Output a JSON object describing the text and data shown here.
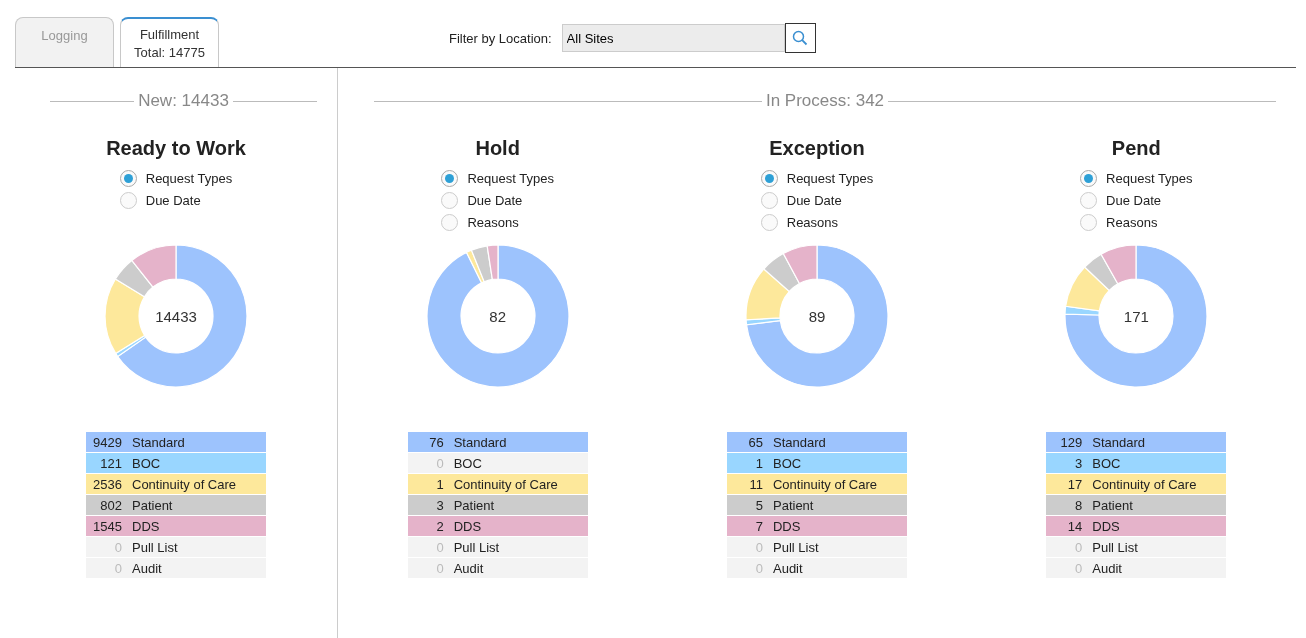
{
  "tabs": [
    {
      "label": "Logging",
      "selected": false
    },
    {
      "label": "Fulfillment",
      "sub": "Total: 14775",
      "selected": true
    }
  ],
  "filter": {
    "label": "Filter by Location:",
    "value": "All Sites"
  },
  "sections": [
    {
      "heading": "New: 14433",
      "panels": [
        {
          "title": "Ready to Work",
          "options": [
            {
              "label": "Request Types",
              "selected": true
            },
            {
              "label": "Due Date",
              "selected": false
            }
          ],
          "total": "14433",
          "legend": [
            {
              "count": "9429",
              "label": "Standard",
              "color": "#9dc3fd",
              "muted": false
            },
            {
              "count": "121",
              "label": "BOC",
              "color": "#99d6ff",
              "muted": false
            },
            {
              "count": "2536",
              "label": "Continuity of Care",
              "color": "#fde89b",
              "muted": false
            },
            {
              "count": "802",
              "label": "Patient",
              "color": "#cccccc",
              "muted": false
            },
            {
              "count": "1545",
              "label": "DDS",
              "color": "#e5b3ca",
              "muted": false
            },
            {
              "count": "0",
              "label": "Pull List",
              "color": "#f3f3f3",
              "muted": true
            },
            {
              "count": "0",
              "label": "Audit",
              "color": "#f3f3f3",
              "muted": true
            }
          ]
        }
      ]
    },
    {
      "heading": "In Process: 342",
      "panels": [
        {
          "title": "Hold",
          "options": [
            {
              "label": "Request Types",
              "selected": true
            },
            {
              "label": "Due Date",
              "selected": false
            },
            {
              "label": "Reasons",
              "selected": false
            }
          ],
          "total": "82",
          "legend": [
            {
              "count": "76",
              "label": "Standard",
              "color": "#9dc3fd",
              "muted": false
            },
            {
              "count": "0",
              "label": "BOC",
              "color": "#f3f3f3",
              "muted": true
            },
            {
              "count": "1",
              "label": "Continuity of Care",
              "color": "#fde89b",
              "muted": false
            },
            {
              "count": "3",
              "label": "Patient",
              "color": "#cccccc",
              "muted": false
            },
            {
              "count": "2",
              "label": "DDS",
              "color": "#e5b3ca",
              "muted": false
            },
            {
              "count": "0",
              "label": "Pull List",
              "color": "#f3f3f3",
              "muted": true
            },
            {
              "count": "0",
              "label": "Audit",
              "color": "#f3f3f3",
              "muted": true
            }
          ]
        },
        {
          "title": "Exception",
          "options": [
            {
              "label": "Request Types",
              "selected": true
            },
            {
              "label": "Due Date",
              "selected": false
            },
            {
              "label": "Reasons",
              "selected": false
            }
          ],
          "total": "89",
          "legend": [
            {
              "count": "65",
              "label": "Standard",
              "color": "#9dc3fd",
              "muted": false
            },
            {
              "count": "1",
              "label": "BOC",
              "color": "#99d6ff",
              "muted": false
            },
            {
              "count": "11",
              "label": "Continuity of Care",
              "color": "#fde89b",
              "muted": false
            },
            {
              "count": "5",
              "label": "Patient",
              "color": "#cccccc",
              "muted": false
            },
            {
              "count": "7",
              "label": "DDS",
              "color": "#e5b3ca",
              "muted": false
            },
            {
              "count": "0",
              "label": "Pull List",
              "color": "#f3f3f3",
              "muted": true
            },
            {
              "count": "0",
              "label": "Audit",
              "color": "#f3f3f3",
              "muted": true
            }
          ]
        },
        {
          "title": "Pend",
          "options": [
            {
              "label": "Request Types",
              "selected": true
            },
            {
              "label": "Due Date",
              "selected": false
            },
            {
              "label": "Reasons",
              "selected": false
            }
          ],
          "total": "171",
          "legend": [
            {
              "count": "129",
              "label": "Standard",
              "color": "#9dc3fd",
              "muted": false
            },
            {
              "count": "3",
              "label": "BOC",
              "color": "#99d6ff",
              "muted": false
            },
            {
              "count": "17",
              "label": "Continuity of Care",
              "color": "#fde89b",
              "muted": false
            },
            {
              "count": "8",
              "label": "Patient",
              "color": "#cccccc",
              "muted": false
            },
            {
              "count": "14",
              "label": "DDS",
              "color": "#e5b3ca",
              "muted": false
            },
            {
              "count": "0",
              "label": "Pull List",
              "color": "#f3f3f3",
              "muted": true
            },
            {
              "count": "0",
              "label": "Audit",
              "color": "#f3f3f3",
              "muted": true
            }
          ]
        }
      ]
    }
  ]
}
